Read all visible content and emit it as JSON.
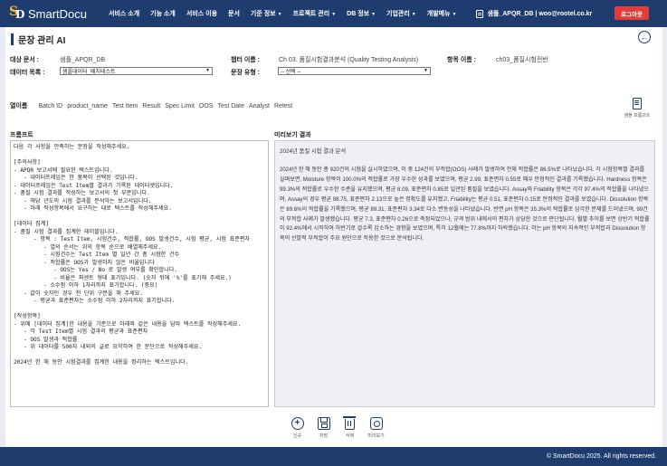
{
  "header": {
    "logo_text": "SmartDocu",
    "menu": [
      {
        "label": "서비스 소개",
        "caret": false
      },
      {
        "label": "기능 소개",
        "caret": false
      },
      {
        "label": "서비스 이용",
        "caret": false
      },
      {
        "label": "문서",
        "caret": false
      },
      {
        "label": "기준 정보",
        "caret": true
      },
      {
        "label": "프로젝트 관리",
        "caret": true
      },
      {
        "label": "DB 정보",
        "caret": true
      },
      {
        "label": "기업관리",
        "caret": true
      },
      {
        "label": "개발메뉴",
        "caret": true
      }
    ],
    "user_text": "샘플_APQR_DB | woo@rootel.co.kr",
    "logout_label": "로그아웃"
  },
  "page": {
    "title": "문장 관리 AI",
    "back_icon": "arrow-left-circle-icon"
  },
  "form": {
    "target_doc_label": "대상 문서 :",
    "target_doc_value": "샘플_APQR_DB",
    "chapter_label": "챕터 이름 :",
    "chapter_value": "Ch 03. 품질시험결과분석 (Quality Testing Analysis)",
    "item_label": "항목 이름 :",
    "item_value": "ch03_품질시험전반",
    "data_list_label": "데이터 목록 :",
    "data_list_value": "샘플데이터_배치테스트",
    "sentence_type_label": "문장 유형 :",
    "sentence_type_value": "-- 선택 --"
  },
  "columns": {
    "label": "열이름",
    "items": [
      "Batch ID",
      "product_name",
      "Test Item",
      "Result",
      "Spec Limit",
      "OOS",
      "Test Date",
      "Analyst",
      "Retest"
    ]
  },
  "sample_prompt": {
    "icon": "document-list-icon",
    "label": "샘플 프롬프트"
  },
  "prompt": {
    "title": "프롬프트",
    "text": "다음 각 사항을 만족하는 문장을 작성해주세요.\n\n[주의사항]\n- APQR 보고서에 필요한 텍스트입니다.\n   - 데이터프레임은 한 품목이 선택된 것입니다.\n- 데이터프레임은 Test Item별 결과가 기록된 데이터셋입니다.\n- 품질 시험 결과를 작성하는 보고서의 첫 부분입니다.\n   - 해당 년도의 시험 결과를 분석하는 보고서입니다.\n   - 아래 작성항목에서 요구하는 대로 텍스트를 작성해주세요.\n\n[데이터 집계]\n- 품질 시험 결과를 집계한 테이블입니다.\n      - 항목 : Test Item, 시험건수, 적합률, OOS 발생건수, 시험 평균, 시험 표준편차\n         - 열의 순서는 위의 항목 순으로 배열해주세요.\n         - 시험건수는 Test Item 별 일년 간 총 시험한 건수\n         - 적합률은 OOS가 발생하지 않은 비율입니다\n            - OOS는 Yes / No 로 발생 여부를 확인합니다.\n            - 비율은 퍼센트 형태 표기입니다. (숫자 뒤에 '%'를 표기해 주세요.)\n         - 소수점 이하 1자리까지 표기합니다. (중요)\n   - 값이 숫자인 경우 천 단위 구분을 해 주세요.\n      - 평균과 표준편차는 소수점 이하 2자리까지 표기합니다.\n\n[작성항목]\n- 위에 [데이터 집계]한 내용을 기준으로 아래와 같은 내용을 담아 텍스트를 작성해주세요.\n   - 각 Test Item별 시험 결과의 평균과 표준편차\n   - OOS 발생과 적합률\n   - 위 데이터를 500자 내외의 글로 요약하여 한 문단으로 작성해주세요.\n\n2024년 한 해 동안 시험결과를 집계한 내용을 정리하는 텍스트입니다."
  },
  "preview": {
    "title": "미리보기 결과",
    "heading": "2024년 품질 시험 결과 분석",
    "body": "2024년 한 해 동안 총 920건의 시험을 실시하였으며, 이 중 124건의 부적합(OOS) 사례가 발생하여 전체 적합률은 86.5%로 나타났습니다. 각 시험항목별 결과를 살펴보면, Moisture 항목이 100.0%의 적합률로 가장 우수한 성과를 보였으며, 평균 2.99, 표준편차 0.55로 매우 안정적인 결과를 기록했습니다. Hardness 항목은 99.3%의 적합률로 우수한 수준을 유지했으며, 평균 8.09, 표준편차 0.85로 일관된 품질을 보였습니다. Assay와 Friability 항목은 각각 97.4%의 적합률을 나타냈으며, Assay의 경우 평균 98.75, 표준편차 2.13으로 높은 정확도를 유지했고, Friability는 평균 0.51, 표준편차 0.15로 안정적인 결과를 보였습니다. Dissolution 항목은 89.6%의 적합률을 기록했으며, 평균 89.31, 표준편차 3.34로 다소 변동성을 나타냈습니다. 반면 pH 항목은 35.3%의 적합률로 심각한 문제를 드러냈으며, 99건의 부적합 사례가 발생했습니다. 평균 7.3, 표준편차 0.26으로 측정되었으나, 규격 범위 내에서의 편차가 상당한 것으로 판단됩니다. 월별 추이를 보면 상반기 적합률이 92.4%에서 시작하여 하반기로 갈수록 감소하는 경향을 보였으며, 특히 12월에는 77.8%까지 하락했습니다. 이는 pH 항목의 지속적인 부적합과 Dissolution 항목의 산발적 부적합이 주요 원인으로 작용한 것으로 분석됩니다."
  },
  "actions": [
    {
      "name": "new-button",
      "icon": "plus-circle-icon",
      "label": "신규"
    },
    {
      "name": "save-button",
      "icon": "save-icon",
      "label": "저장"
    },
    {
      "name": "delete-button",
      "icon": "trash-icon",
      "label": "삭제"
    },
    {
      "name": "preview-button",
      "icon": "preview-icon",
      "label": "미리보기"
    }
  ],
  "footer": {
    "text": "© SmartDocu 2025. All rights reserved."
  },
  "colors": {
    "nav": "#1e3c6e",
    "logout": "#e23b3b",
    "logo_accent": "#f3b13b"
  }
}
